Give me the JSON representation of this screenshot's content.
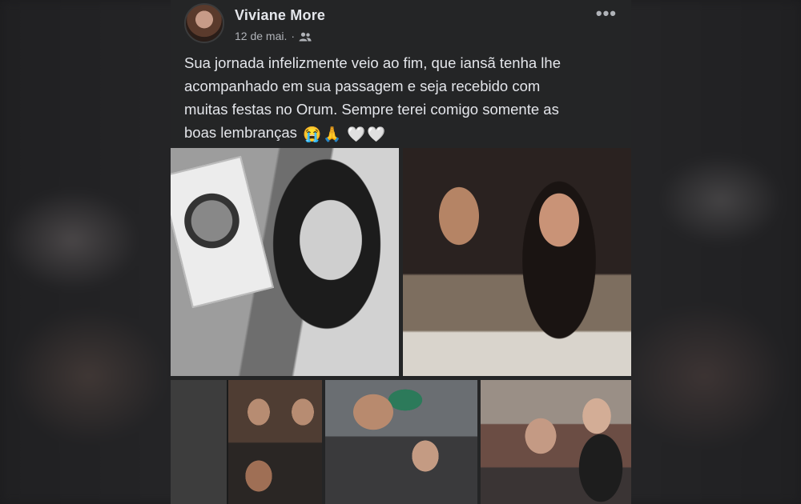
{
  "post": {
    "author": "Viviane More",
    "date": "12 de mai.",
    "separator": "·",
    "audience_icon": "friends-icon",
    "more_label": "•••",
    "text_lines": [
      "Sua jornada infelizmente veio ao fim, que iansã tenha lhe",
      "acompanhado em sua passagem e seja recebido com",
      "muitas festas no Orum. Sempre terei comigo somente as",
      "boas lembranças"
    ],
    "text_emojis": [
      "😭",
      "🙏",
      "🤍",
      "🤍"
    ],
    "photos": [
      {
        "name": "photo-1",
        "description_icon": "photo"
      },
      {
        "name": "photo-2",
        "description_icon": "photo"
      },
      {
        "name": "photo-3",
        "description_icon": "photo"
      },
      {
        "name": "photo-4",
        "description_icon": "photo"
      },
      {
        "name": "photo-5",
        "description_icon": "photo"
      }
    ]
  },
  "colors": {
    "post_background": "#242526",
    "primary_text": "#e4e6eb",
    "secondary_text": "#b0b3b8"
  }
}
